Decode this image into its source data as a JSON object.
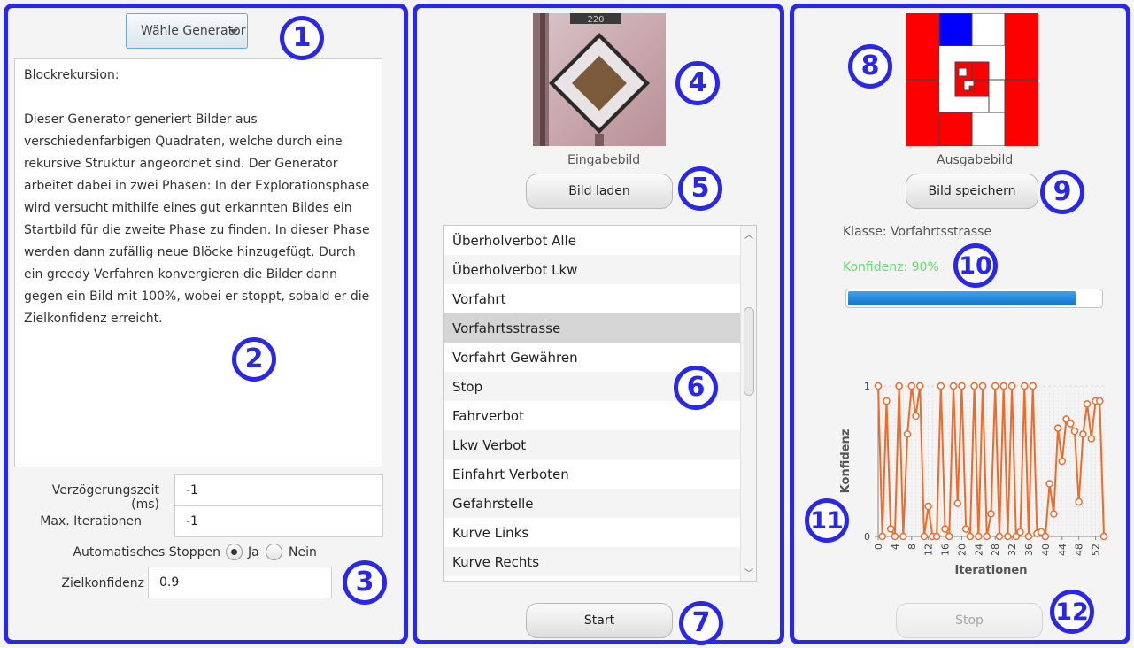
{
  "left_panel": {
    "generator_dropdown": "Wähle Generator",
    "description": "Blockrekursion:\n\nDieser Generator generiert Bilder aus verschiedenfarbigen Quadraten, welche durch eine rekursive Struktur angeordnet sind. Der Generator arbeitet dabei in zwei Phasen: In der Explorationsphase wird versucht mithilfe eines gut erkannten Bildes ein Startbild für die zweite Phase zu finden. In dieser Phase werden dann zufällig neue Blöcke hinzugefügt. Durch ein greedy Verfahren konvergieren die Bilder dann gegen ein Bild mit 100%, wobei er stoppt, sobald er die Zielkonfidenz erreicht.",
    "delay_label": "Verzögerungszeit (ms)",
    "delay_value": "-1",
    "max_iter_label": "Max. Iterationen",
    "max_iter_value": "-1",
    "auto_stop_label": "Automatisches Stoppen",
    "auto_stop_yes": "Ja",
    "auto_stop_no": "Nein",
    "auto_stop_selected": "Ja",
    "target_conf_label": "Zielkonfidenz",
    "target_conf_value": "0.9"
  },
  "middle_panel": {
    "input_caption": "Eingabebild",
    "load_button": "Bild laden",
    "classes": [
      "Überholverbot Alle",
      "Überholverbot Lkw",
      "Vorfahrt",
      "Vorfahrtsstrasse",
      "Vorfahrt Gewähren",
      "Stop",
      "Fahrverbot",
      "Lkw Verbot",
      "Einfahrt Verboten",
      "Gefahrstelle",
      "Kurve Links",
      "Kurve Rechts"
    ],
    "selected_class": "Vorfahrtsstrasse",
    "start_button": "Start",
    "sign_plate_text": "220"
  },
  "right_panel": {
    "output_caption": "Ausgabebild",
    "save_button": "Bild speichern",
    "class_label": "Klasse: Vorfahrtsstrasse",
    "confidence_label": "Konfidenz: 90%",
    "confidence_value": 0.9,
    "stop_button": "Stop",
    "stop_enabled": false
  },
  "markers": [
    "1",
    "2",
    "3",
    "4",
    "5",
    "6",
    "7",
    "8",
    "9",
    "10",
    "11",
    "12"
  ],
  "colors": {
    "marker": "#2828e6",
    "confidence_text": "#5fe06a",
    "progress": "#1e82dc",
    "chart_line": "#f06a2a",
    "output_red": "#ff0000",
    "output_blue": "#0000ff"
  },
  "chart_data": {
    "type": "line",
    "xlabel": "Iterationen",
    "ylabel": "Konfidenz",
    "ylim": [
      0,
      1
    ],
    "xlim": [
      0,
      54
    ],
    "x_ticks": [
      0,
      4,
      8,
      12,
      16,
      20,
      24,
      28,
      32,
      36,
      40,
      44,
      48,
      52
    ],
    "y_ticks": [
      0,
      1
    ],
    "series": [
      {
        "name": "",
        "x": [
          0,
          1,
          2,
          3,
          4,
          5,
          6,
          7,
          8,
          9,
          10,
          11,
          12,
          13,
          14,
          15,
          16,
          17,
          18,
          19,
          20,
          21,
          22,
          23,
          24,
          25,
          26,
          27,
          28,
          29,
          30,
          31,
          32,
          33,
          34,
          35,
          36,
          37,
          38,
          39,
          40,
          41,
          42,
          43,
          44,
          45,
          46,
          47,
          48,
          49,
          50,
          51,
          52,
          53,
          54
        ],
        "values": [
          1.0,
          0.0,
          0.9,
          0.05,
          0.0,
          1.0,
          0.0,
          0.68,
          1.0,
          0.8,
          1.0,
          0.0,
          0.2,
          0.0,
          0.0,
          1.0,
          0.05,
          0.0,
          1.0,
          0.22,
          1.0,
          0.05,
          0.0,
          1.0,
          0.0,
          1.0,
          0.0,
          0.15,
          1.0,
          0.0,
          1.0,
          0.0,
          1.0,
          0.0,
          0.03,
          1.0,
          0.0,
          1.0,
          0.02,
          0.03,
          0.0,
          0.35,
          0.15,
          0.72,
          0.5,
          0.78,
          0.75,
          0.7,
          0.23,
          0.68,
          0.88,
          0.65,
          0.9,
          0.9,
          0.0
        ]
      }
    ],
    "grid": true
  }
}
